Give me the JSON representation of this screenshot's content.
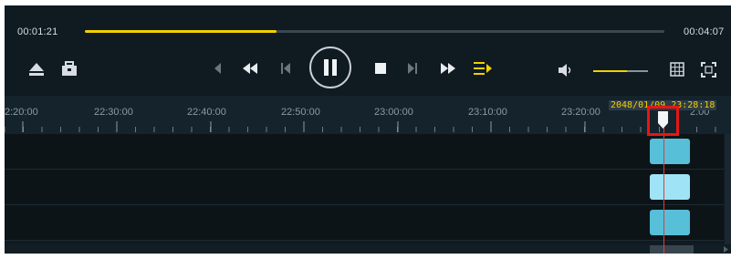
{
  "player": {
    "current_time": "00:01:21",
    "total_time": "00:04:07",
    "progress_fraction": 0.33,
    "volume_fraction": 0.62,
    "accent_color": "#f2d000"
  },
  "controls": {
    "eject_icon": "eject-icon",
    "toolbox_icon": "toolbox-icon",
    "prev_icon": "previous-icon",
    "rewind_icon": "rewind-icon",
    "step_back_icon": "step-back-icon",
    "pause_icon": "pause-icon",
    "stop_icon": "stop-icon",
    "step_forward_icon": "step-forward-icon",
    "fast_forward_icon": "fast-forward-icon",
    "playlist_icon": "playlist-icon",
    "volume_icon": "volume-icon",
    "grid_icon": "grid-icon",
    "fullscreen_icon": "fullscreen-icon"
  },
  "timeline": {
    "tick_labels": [
      "2:20:00",
      "22:30:00",
      "22:40:00",
      "22:50:00",
      "23:00:00",
      "23:10:00",
      "23:20:00",
      "2:00"
    ],
    "cursor_label": "2048/01/09 23:28:18"
  }
}
